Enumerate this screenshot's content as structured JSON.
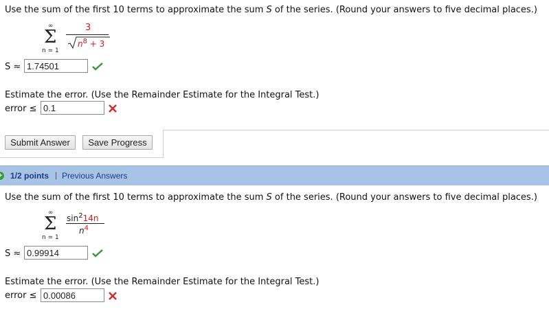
{
  "problem1": {
    "question": {
      "pre": "Use the sum of the first 10 terms to approximate the sum ",
      "var": "S",
      "post": " of the series. (Round your answers to five decimal places.)"
    },
    "series": {
      "upper": "∞",
      "lower": "n = 1",
      "numerator": "3",
      "denominator_base": "n",
      "denominator_exp": "8",
      "denominator_tail": " + 3"
    },
    "sum_label": "S ≈",
    "sum_value": "1.74501",
    "error_prompt": "Estimate the error. (Use the Remainder Estimate for the Integral Test.)",
    "error_label": "error ≤",
    "error_value": "0.1"
  },
  "buttons": {
    "submit": "Submit Answer",
    "save": "Save Progress"
  },
  "status_bar": {
    "points": "1/2 points",
    "separator": "|",
    "previous": "Previous Answers"
  },
  "problem2": {
    "question": {
      "pre": "Use the sum of the first 10 terms to approximate the sum ",
      "var": "S",
      "post": " of the series. (Round your answers to five decimal places.)"
    },
    "series": {
      "upper": "∞",
      "lower": "n = 1",
      "num_fn": "sin",
      "num_exp": "2",
      "num_arg": "14n",
      "den_base": "n",
      "den_exp": "4"
    },
    "sum_label": "S ≈",
    "sum_value": "0.99914",
    "error_prompt": "Estimate the error. (Use the Remainder Estimate for the Integral Test.)",
    "error_label": "error ≤",
    "error_value": "0.00086"
  },
  "icons": {
    "check_color": "#3a9a3a",
    "cross_color": "#d42b2b"
  }
}
